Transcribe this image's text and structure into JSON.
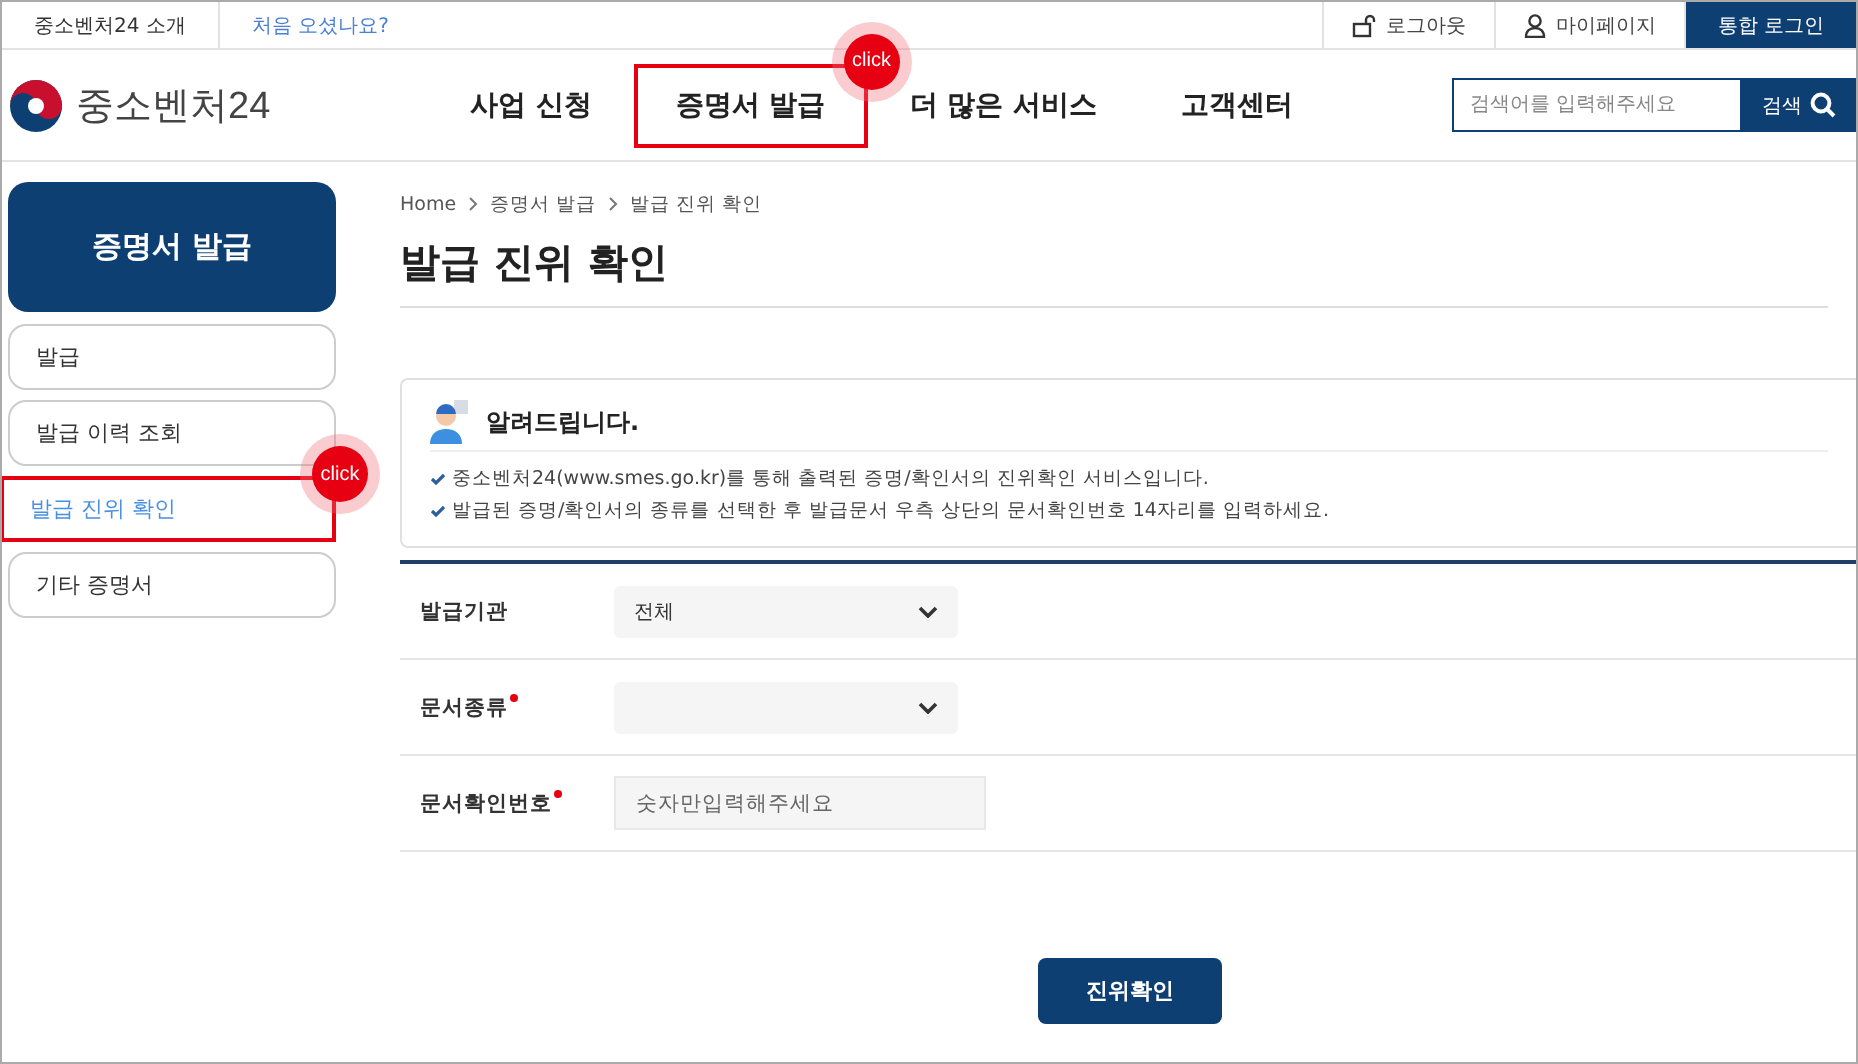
{
  "top_bar": {
    "links": [
      {
        "label": "중소벤처24 소개",
        "kind": "plain"
      },
      {
        "label": "처음 오셨나요?",
        "kind": "highlight"
      }
    ],
    "account": [
      {
        "label": "로그아웃",
        "kind": "logout"
      },
      {
        "label": "마이페이지",
        "kind": "mypage"
      },
      {
        "label": "통합 로그인",
        "kind": "primary"
      }
    ]
  },
  "header": {
    "logo": "중소벤처24",
    "nav": [
      {
        "label": "사업 신청"
      },
      {
        "label": "증명서 발급",
        "annotation": "click"
      },
      {
        "label": "더 많은 서비스"
      },
      {
        "label": "고객센터"
      }
    ],
    "search": {
      "placeholder": "검색어를 입력해주세요",
      "button": "검색"
    }
  },
  "sidebar": {
    "title": "증명서 발급",
    "items": [
      {
        "label": "발급",
        "selected": false
      },
      {
        "label": "발급 이력 조회",
        "selected": false
      },
      {
        "label": "발급 진위 확인",
        "selected": true,
        "annotation": "click"
      },
      {
        "label": "기타 증명서",
        "selected": false
      }
    ]
  },
  "breadcrumb": [
    "Home",
    "증명서 발급",
    "발급 진위 확인"
  ],
  "page_title": "발급 진위 확인",
  "notice": {
    "title": "알려드립니다.",
    "lines": [
      "중소벤처24(www.smes.go.kr)를 통해 출력된 증명/확인서의 진위확인 서비스입니다.",
      "발급된 증명/확인서의 종류를 선택한 후 발급문서 우측 상단의 문서확인번호 14자리를 입력하세요."
    ]
  },
  "form": {
    "fields": [
      {
        "label": "발급기관",
        "kind": "select",
        "required": false,
        "value": "전체"
      },
      {
        "label": "문서종류",
        "kind": "select",
        "required": true
      },
      {
        "label": "문서확인번호",
        "kind": "input",
        "required": true,
        "placeholder": "숫자만입력해주세요"
      }
    ]
  },
  "submit": "진위확인"
}
